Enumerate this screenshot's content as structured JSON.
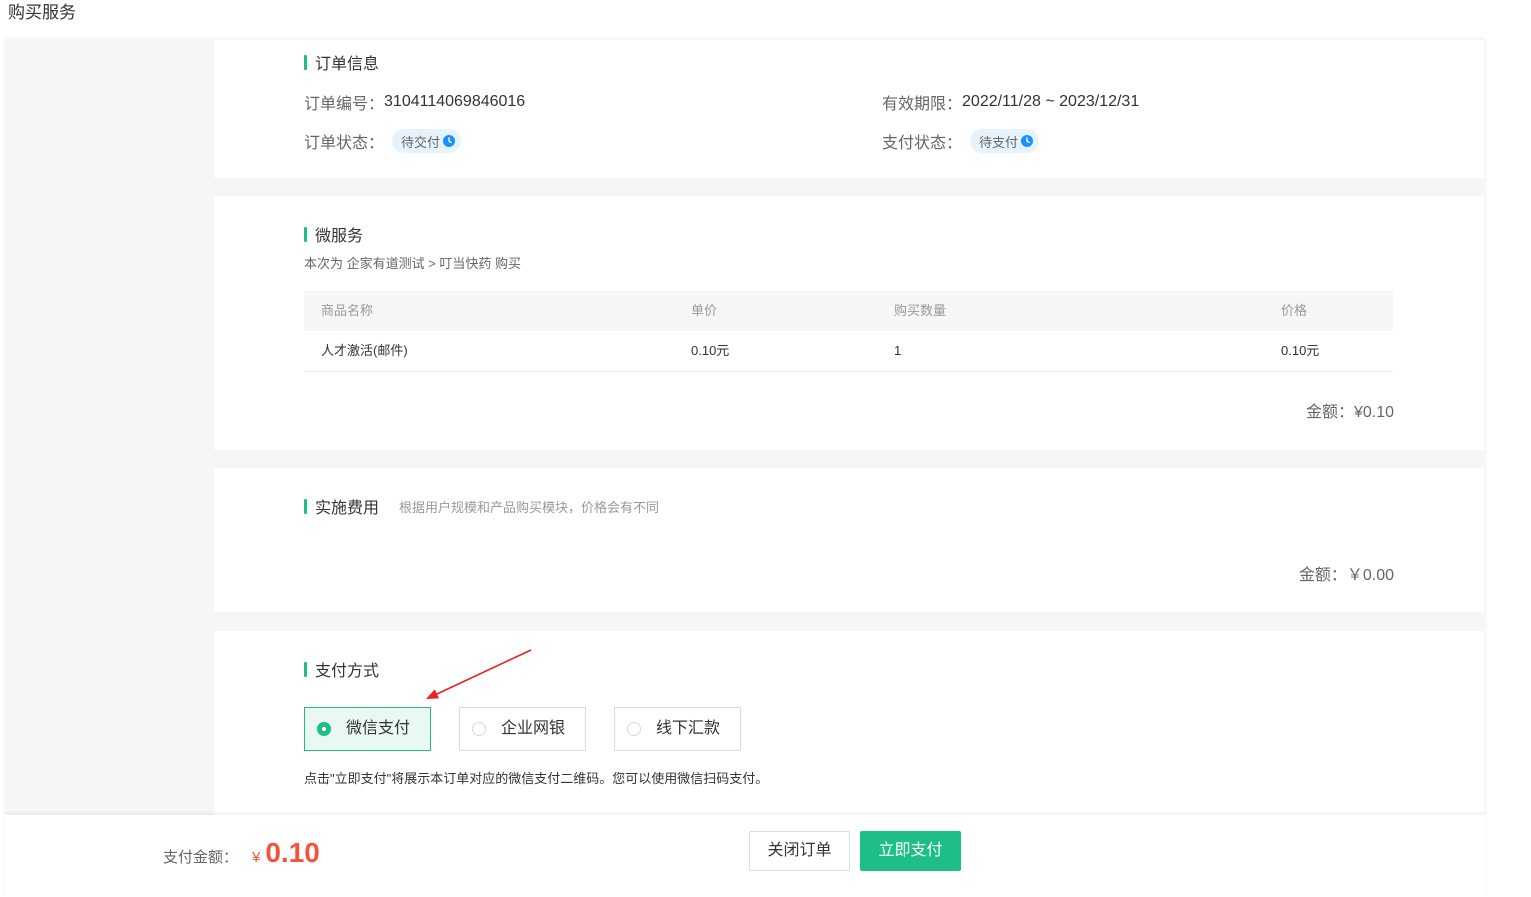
{
  "page": {
    "title": "购买服务"
  },
  "order_info": {
    "heading": "订单信息",
    "order_no_label": "订单编号：",
    "order_no": "3104114069846016",
    "validity_label": "有效期限：",
    "validity": "2022/11/28 ~ 2023/12/31",
    "order_status_label": "订单状态：",
    "order_status": "待交付",
    "pay_status_label": "支付状态：",
    "pay_status": "待支付",
    "status_icon": "clock-icon"
  },
  "micro_service": {
    "heading": "微服务",
    "subtitle": "本次为 企家有道测试 > 叮当快药 购买",
    "columns": [
      "商品名称",
      "单价",
      "购买数量",
      "价格"
    ],
    "rows": [
      [
        "人才激活(邮件)",
        "0.10元",
        "1",
        "0.10元"
      ]
    ],
    "amount_label": "金额：",
    "amount": "¥0.10"
  },
  "implementation": {
    "heading": "实施费用",
    "note": "根据用户规模和产品购买模块，价格会有不同",
    "amount_label": "金额：",
    "amount": "￥0.00"
  },
  "payment": {
    "heading": "支付方式",
    "options": [
      {
        "label": "微信支付",
        "selected": true
      },
      {
        "label": "企业网银",
        "selected": false
      },
      {
        "label": "线下汇款",
        "selected": false
      }
    ],
    "hint": "点击\"立即支付\"将展示本订单对应的微信支付二维码。您可以使用微信扫码支付。"
  },
  "footer": {
    "amount_label": "支付金额：",
    "currency": "¥",
    "amount": "0.10",
    "close_button": "关闭订单",
    "pay_button": "立即支付"
  },
  "colors": {
    "accent": "#1dbe88",
    "price": "#f5543c",
    "badge_bg": "#e6f3fd",
    "badge_icon": "#1a90ff",
    "annotation_arrow": "#e8221d"
  }
}
